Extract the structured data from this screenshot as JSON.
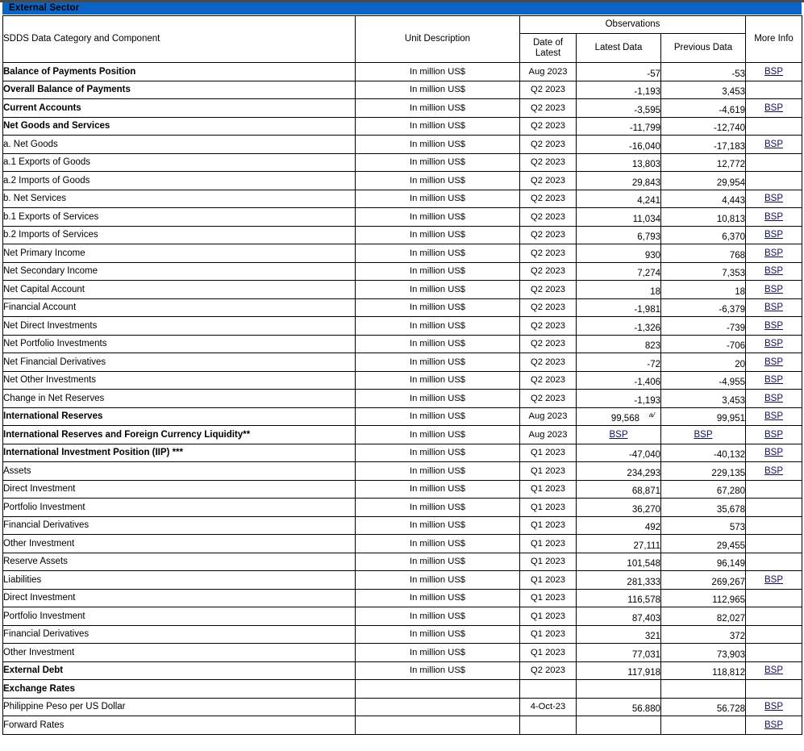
{
  "banner": {
    "title": "External Sector"
  },
  "colors": {
    "banner_bg": "#0B63C5",
    "link": "#101060",
    "border": "#000000"
  },
  "header": {
    "category": "SDDS Data Category and Component",
    "unit": "Unit Description",
    "observations": "Observations",
    "date_of_latest_line1": "Date of",
    "date_of_latest_line2": "Latest",
    "latest_data": "Latest Data",
    "previous_data": "Previous Data",
    "more_info": "More Info"
  },
  "link_label": "BSP",
  "footnote_marks": {
    "a_slash": "a/",
    "double_star": "**",
    "triple_star": "***"
  },
  "rows": [
    {
      "label": "Balance of Payments Position",
      "bold": true,
      "indent": 0,
      "unit": "In million US$",
      "date": "Aug 2023",
      "latest": "-57",
      "previous": "-53",
      "more": "BSP"
    },
    {
      "label": "Overall Balance of Payments",
      "bold": true,
      "indent": 0,
      "unit": "In million US$",
      "date": "Q2 2023",
      "latest": "-1,193",
      "previous": "3,453",
      "more": ""
    },
    {
      "label": "Current Accounts",
      "bold": true,
      "indent": 0,
      "unit": "In million US$",
      "date": "Q2 2023",
      "latest": "-3,595",
      "previous": "-4,619",
      "more": "BSP"
    },
    {
      "label": "Net Goods and Services",
      "bold": true,
      "indent": 0,
      "unit": "In million US$",
      "date": "Q2 2023",
      "latest": "-11,799",
      "previous": "-12,740",
      "more": ""
    },
    {
      "label": "a.  Net Goods",
      "bold": false,
      "indent": 1,
      "unit": "In million US$",
      "date": "Q2 2023",
      "latest": "-16,040",
      "previous": "-17,183",
      "more": "BSP"
    },
    {
      "label": "a.1    Exports of Goods",
      "bold": false,
      "indent": 2,
      "unit": "In million US$",
      "date": "Q2 2023",
      "latest": "13,803",
      "previous": "12,772",
      "more": ""
    },
    {
      "label": "a.2    Imports of Goods",
      "bold": false,
      "indent": 2,
      "unit": "In million US$",
      "date": "Q2 2023",
      "latest": "29,843",
      "previous": "29,954",
      "more": ""
    },
    {
      "label": "b.  Net Services",
      "bold": false,
      "indent": 1,
      "unit": "In million US$",
      "date": "Q2 2023",
      "latest": "4,241",
      "previous": "4,443",
      "more": "BSP"
    },
    {
      "label": "b.1   Exports of Services",
      "bold": false,
      "indent": 2,
      "unit": "In million US$",
      "date": "Q2 2023",
      "latest": "11,034",
      "previous": "10,813",
      "more": "BSP"
    },
    {
      "label": "b.2   Imports of Services",
      "bold": false,
      "indent": 2,
      "unit": "In million US$",
      "date": "Q2 2023",
      "latest": "6,793",
      "previous": "6,370",
      "more": "BSP"
    },
    {
      "label": "Net Primary Income",
      "bold": false,
      "indent": 0,
      "unit": "In million US$",
      "date": "Q2 2023",
      "latest": "930",
      "previous": "768",
      "more": "BSP"
    },
    {
      "label": "Net Secondary Income",
      "bold": false,
      "indent": 0,
      "unit": "In million US$",
      "date": "Q2 2023",
      "latest": "7,274",
      "previous": "7,353",
      "more": "BSP"
    },
    {
      "label": "Net Capital Account",
      "bold": false,
      "indent": 0,
      "unit": "In million US$",
      "date": "Q2 2023",
      "latest": "18",
      "previous": "18",
      "more": "BSP"
    },
    {
      "label": "Financial Account",
      "bold": false,
      "indent": 0,
      "unit": "In million US$",
      "date": "Q2 2023",
      "latest": "-1,981",
      "previous": "-6,379",
      "more": "BSP"
    },
    {
      "label": "Net Direct Investments",
      "bold": false,
      "indent": 0,
      "unit": "In million US$",
      "date": "Q2 2023",
      "latest": "-1,326",
      "previous": "-739",
      "more": "BSP"
    },
    {
      "label": "Net Portfolio Investments",
      "bold": false,
      "indent": 0,
      "unit": "In million US$",
      "date": "Q2 2023",
      "latest": "823",
      "previous": "-706",
      "more": "BSP"
    },
    {
      "label": "Net  Financial Derivatives",
      "bold": false,
      "indent": 0,
      "unit": "In million US$",
      "date": "Q2 2023",
      "latest": "-72",
      "previous": "20",
      "more": "BSP"
    },
    {
      "label": "Net Other Investments",
      "bold": false,
      "indent": 0,
      "unit": "In million US$",
      "date": "Q2 2023",
      "latest": "-1,406",
      "previous": "-4,955",
      "more": "BSP"
    },
    {
      "label": "Change in Net Reserves",
      "bold": false,
      "indent": 0,
      "unit": "In million US$",
      "date": "Q2 2023",
      "latest": "-1,193",
      "previous": "3,453",
      "more": "BSP"
    },
    {
      "label": "International Reserves",
      "bold": true,
      "indent": 0,
      "unit": "In million US$",
      "date": "Aug 2023",
      "latest": "99,568",
      "latest_footnote": "a/",
      "previous": "99,951",
      "more": "BSP"
    },
    {
      "label": "International Reserves and Foreign Currency Liquidity**",
      "bold": true,
      "indent": 0,
      "unit": "In million US$",
      "date": "Aug 2023",
      "latest_link": "BSP",
      "previous_link": "BSP",
      "more": "BSP"
    },
    {
      "label": "International Investment Position (IIP) ***",
      "bold": true,
      "indent": 0,
      "unit": "In million US$",
      "date": "Q1 2023",
      "latest": "-47,040",
      "previous": "-40,132",
      "more": "BSP"
    },
    {
      "label": "Assets",
      "bold": false,
      "indent": 3,
      "unit": "In million US$",
      "date": "Q1 2023",
      "latest": "234,293",
      "previous": "229,135",
      "more": "BSP"
    },
    {
      "label": "Direct Investment",
      "bold": false,
      "indent": 4,
      "unit": "In million US$",
      "date": "Q1 2023",
      "latest": "68,871",
      "previous": "67,280",
      "more": ""
    },
    {
      "label": "Portfolio Investment",
      "bold": false,
      "indent": 4,
      "unit": "In million US$",
      "date": "Q1 2023",
      "latest": "36,270",
      "previous": "35,678",
      "more": ""
    },
    {
      "label": "Financial Derivatives",
      "bold": false,
      "indent": 4,
      "unit": "In million US$",
      "date": "Q1 2023",
      "latest": "492",
      "previous": "573",
      "more": ""
    },
    {
      "label": "Other Investment",
      "bold": false,
      "indent": 4,
      "unit": "In million US$",
      "date": "Q1 2023",
      "latest": "27,111",
      "previous": "29,455",
      "more": ""
    },
    {
      "label": "Reserve Assets",
      "bold": false,
      "indent": 4,
      "unit": "In million US$",
      "date": "Q1 2023",
      "latest": "101,548",
      "previous": "96,149",
      "more": ""
    },
    {
      "label": "Liabilities",
      "bold": false,
      "indent": 3,
      "unit": "In million US$",
      "date": "Q1 2023",
      "latest": "281,333",
      "previous": "269,267",
      "more": "BSP"
    },
    {
      "label": "Direct Investment",
      "bold": false,
      "indent": 4,
      "unit": "In million US$",
      "date": "Q1 2023",
      "latest": "116,578",
      "previous": "112,965",
      "more": ""
    },
    {
      "label": "Portfolio Investment",
      "bold": false,
      "indent": 4,
      "unit": "In million US$",
      "date": "Q1 2023",
      "latest": "87,403",
      "previous": "82,027",
      "more": ""
    },
    {
      "label": "Financial Derivatives",
      "bold": false,
      "indent": 4,
      "unit": "In million US$",
      "date": "Q1 2023",
      "latest": "321",
      "previous": "372",
      "more": ""
    },
    {
      "label": "Other Investment",
      "bold": false,
      "indent": 4,
      "unit": "In million US$",
      "date": "Q1 2023",
      "latest": "77,031",
      "previous": "73,903",
      "more": ""
    },
    {
      "label": "External Debt",
      "bold": true,
      "indent": 0,
      "unit": "In million US$",
      "date": "Q2 2023",
      "latest": "117,918",
      "previous": "118,812",
      "more": "BSP"
    },
    {
      "label": "Exchange Rates",
      "bold": true,
      "indent": 0,
      "unit": "",
      "date": "",
      "latest": "",
      "previous": "",
      "more": ""
    },
    {
      "label": "Philippine Peso per US Dollar",
      "bold": false,
      "indent": 0,
      "unit": "",
      "date": "4-Oct-23",
      "latest": "56.880",
      "previous": "56.728",
      "more": "BSP"
    },
    {
      "label": "Forward Rates",
      "bold": false,
      "indent": 0,
      "unit": "",
      "date": "",
      "latest": "",
      "previous": "",
      "more": "BSP"
    }
  ]
}
